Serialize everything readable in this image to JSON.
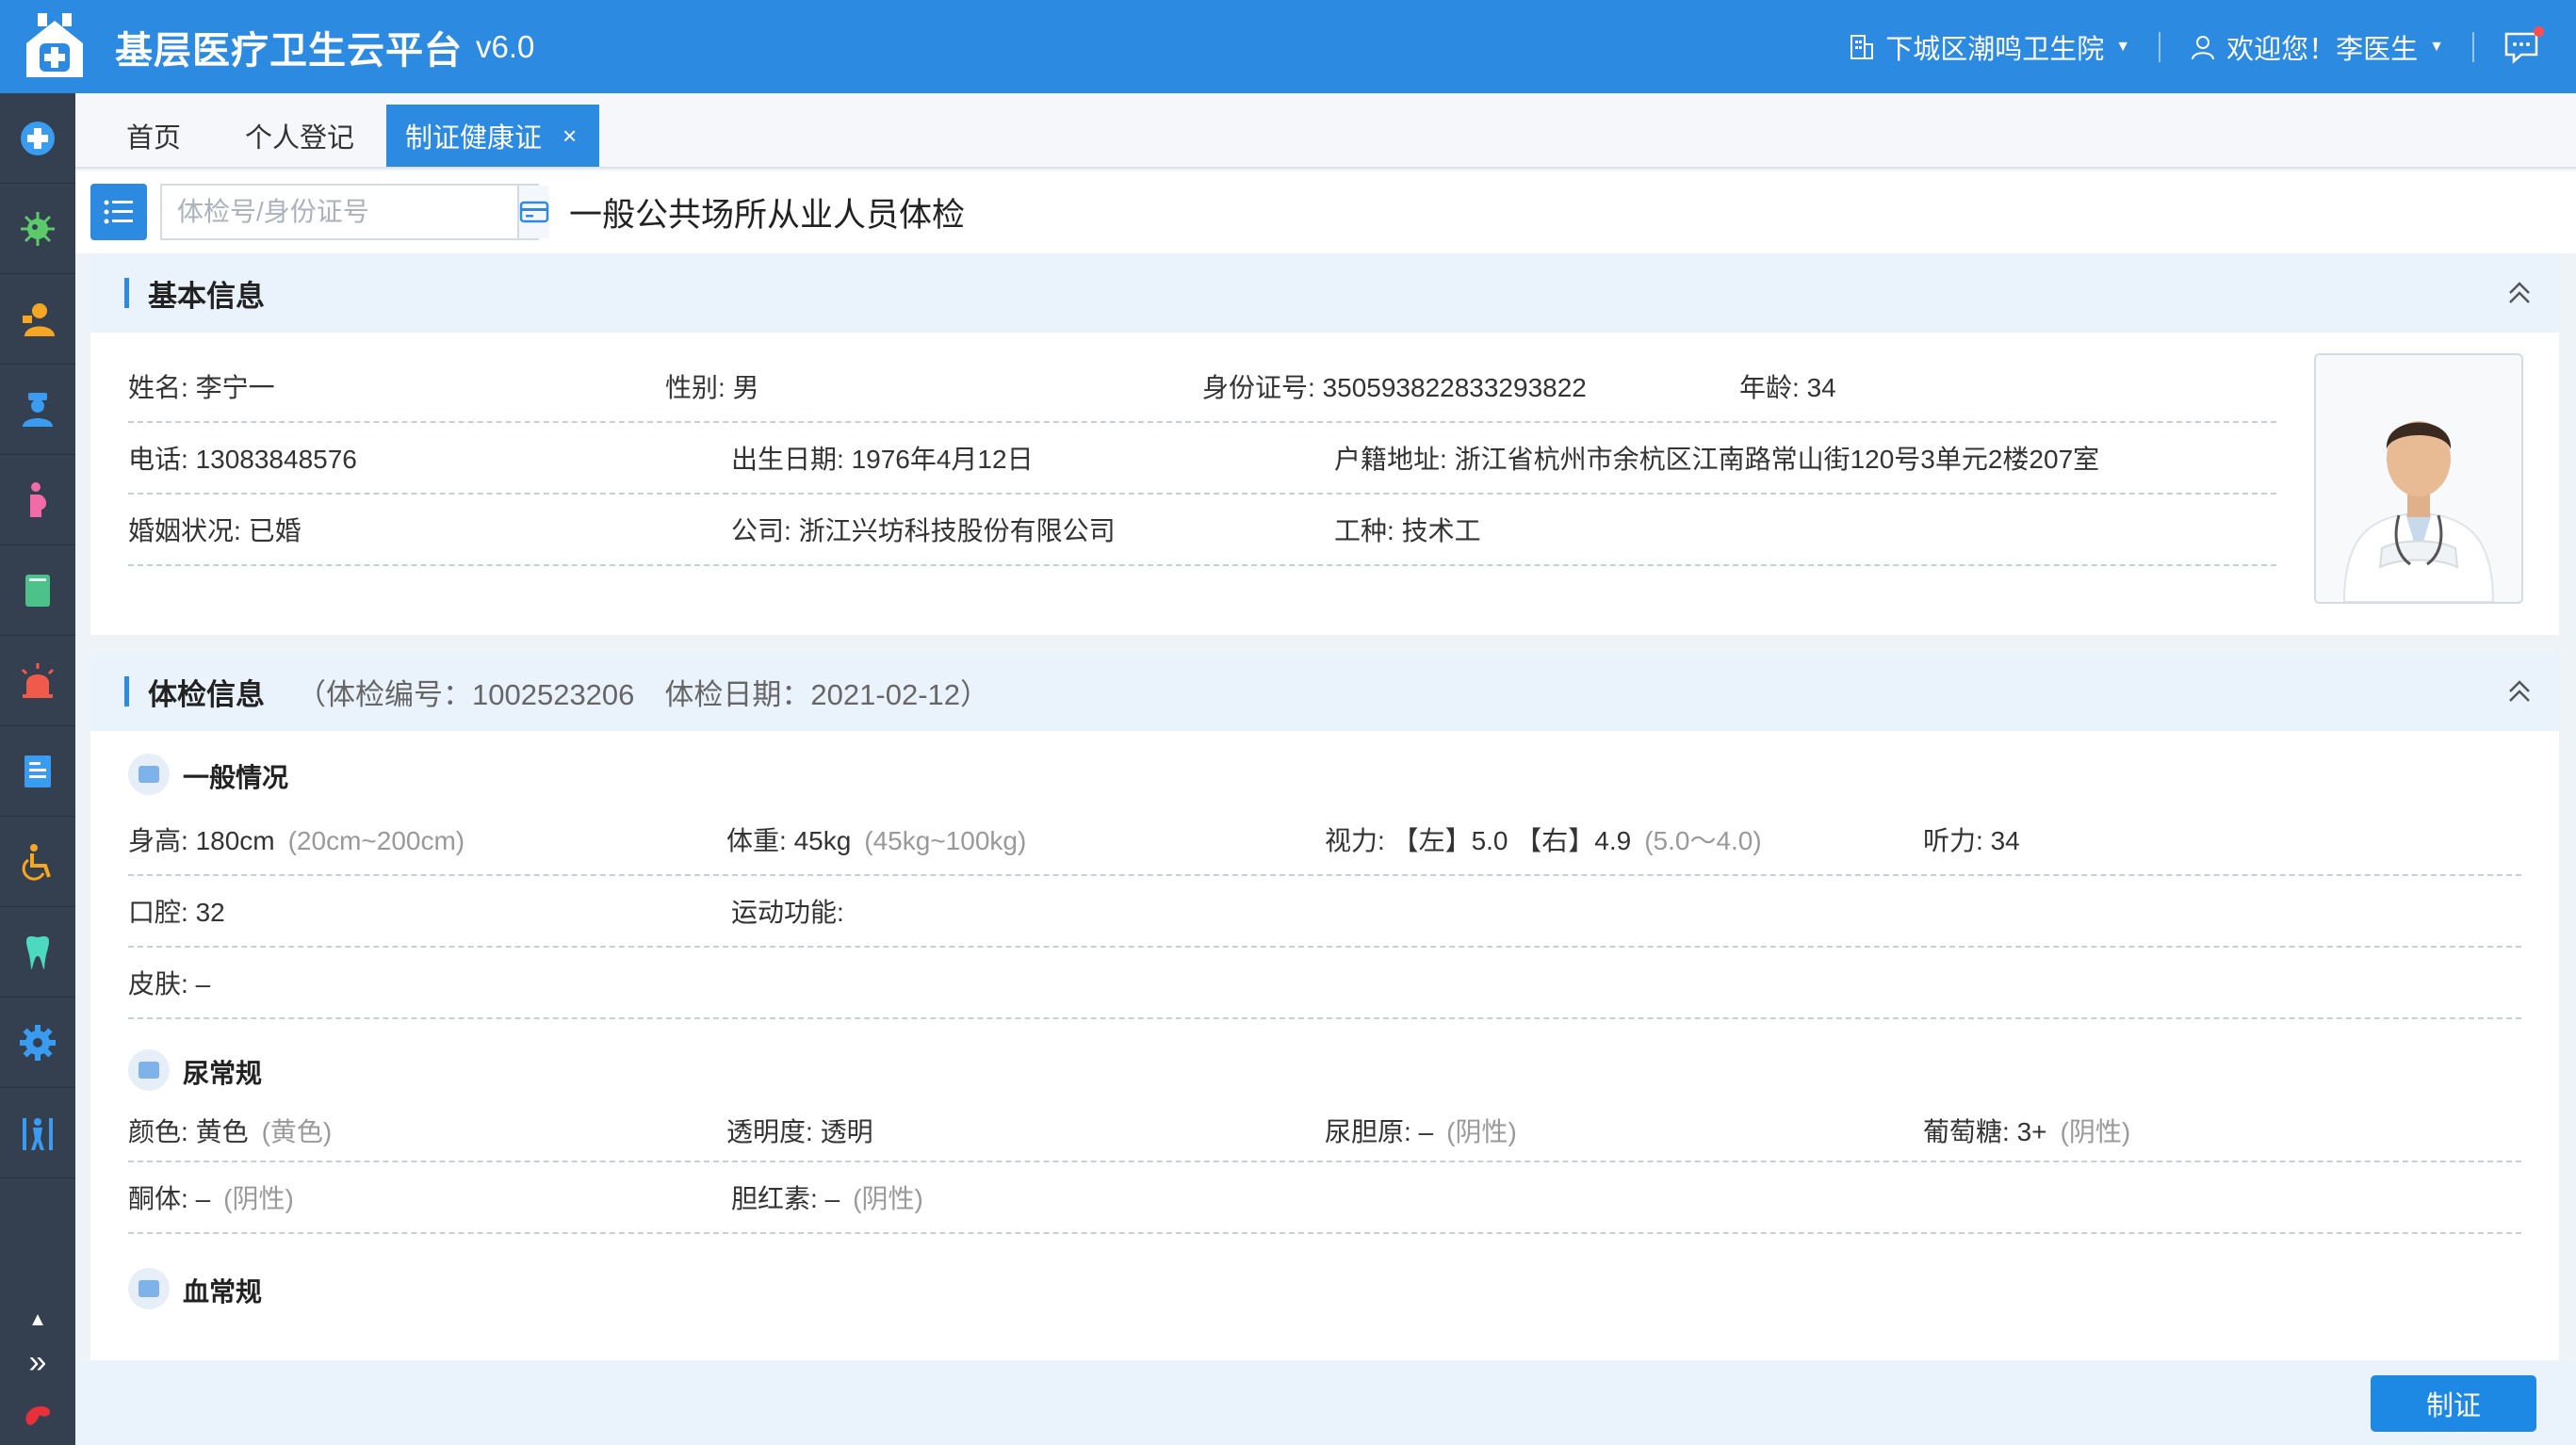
{
  "header": {
    "title": "基层医疗卫生云平台",
    "version": "v6.0",
    "org": "下城区潮鸣卫生院",
    "welcome": "欢迎您！李医生"
  },
  "sidebar": {
    "items": [
      "medical-cross-icon",
      "virus-icon",
      "doctor-icon",
      "nurse-icon",
      "pregnant-icon",
      "book-icon",
      "alarm-icon",
      "report-icon",
      "wheelchair-icon",
      "tooth-icon",
      "gear-icon",
      "elderly-icon"
    ]
  },
  "tabs": [
    "首页",
    "个人登记",
    "制证健康证"
  ],
  "toolbar": {
    "search_placeholder": "体检号/身份证号",
    "page_title": "一般公共场所从业人员体检"
  },
  "basic": {
    "title": "基本信息",
    "name_label": "姓名:",
    "name": "李宁一",
    "gender_label": "性别:",
    "gender": "男",
    "id_label": "身份证号:",
    "id": "350593822833293822",
    "age_label": "年龄:",
    "age": "34",
    "phone_label": "电话:",
    "phone": "13083848576",
    "birth_label": "出生日期:",
    "birth": "1976年4月12日",
    "address_label": "户籍地址:",
    "address": "浙江省杭州市余杭区江南路常山街120号3单元2楼207室",
    "marital_label": "婚姻状况:",
    "marital": "已婚",
    "company_label": "公司:",
    "company": "浙江兴坊科技股份有限公司",
    "job_label": "工种:",
    "job": "技术工"
  },
  "exam": {
    "title": "体检信息",
    "no_text": "（体检编号：1002523206",
    "date_text": "体检日期：2021-02-12）",
    "general": {
      "title": "一般情况",
      "height_label": "身高:",
      "height": "180cm",
      "height_range": "(20cm~200cm)",
      "weight_label": "体重:",
      "weight": "45kg",
      "weight_range": "(45kg~100kg)",
      "vision_label": "视力:",
      "vision": "【左】5.0 【右】4.9",
      "vision_range": "(5.0～4.0)",
      "hearing_label": "听力:",
      "hearing": "34",
      "oral_label": "口腔:",
      "oral": "32",
      "motor_label": "运动功能:",
      "motor": "",
      "skin_label": "皮肤:",
      "skin": "–"
    },
    "urine": {
      "title": "尿常规",
      "color_label": "颜色:",
      "color": "黄色",
      "color_range": "(黄色)",
      "clarity_label": "透明度:",
      "clarity": "透明",
      "urobilinogen_label": "尿胆原:",
      "urobilinogen": "–",
      "urobilinogen_range": "(阴性)",
      "glucose_label": "葡萄糖:",
      "glucose": "3+",
      "glucose_range": "(阴性)",
      "ketone_label": "酮体:",
      "ketone": "–",
      "ketone_range": "(阴性)",
      "bilirubin_label": "胆红素:",
      "bilirubin": "–",
      "bilirubin_range": "(阴性)"
    },
    "blood": {
      "title": "血常规"
    }
  },
  "footer": {
    "submit_label": "制证"
  },
  "colors": {
    "primary": "#2c8ae0",
    "sidebar": "#34404f",
    "panel_head": "#eaf3fc"
  }
}
